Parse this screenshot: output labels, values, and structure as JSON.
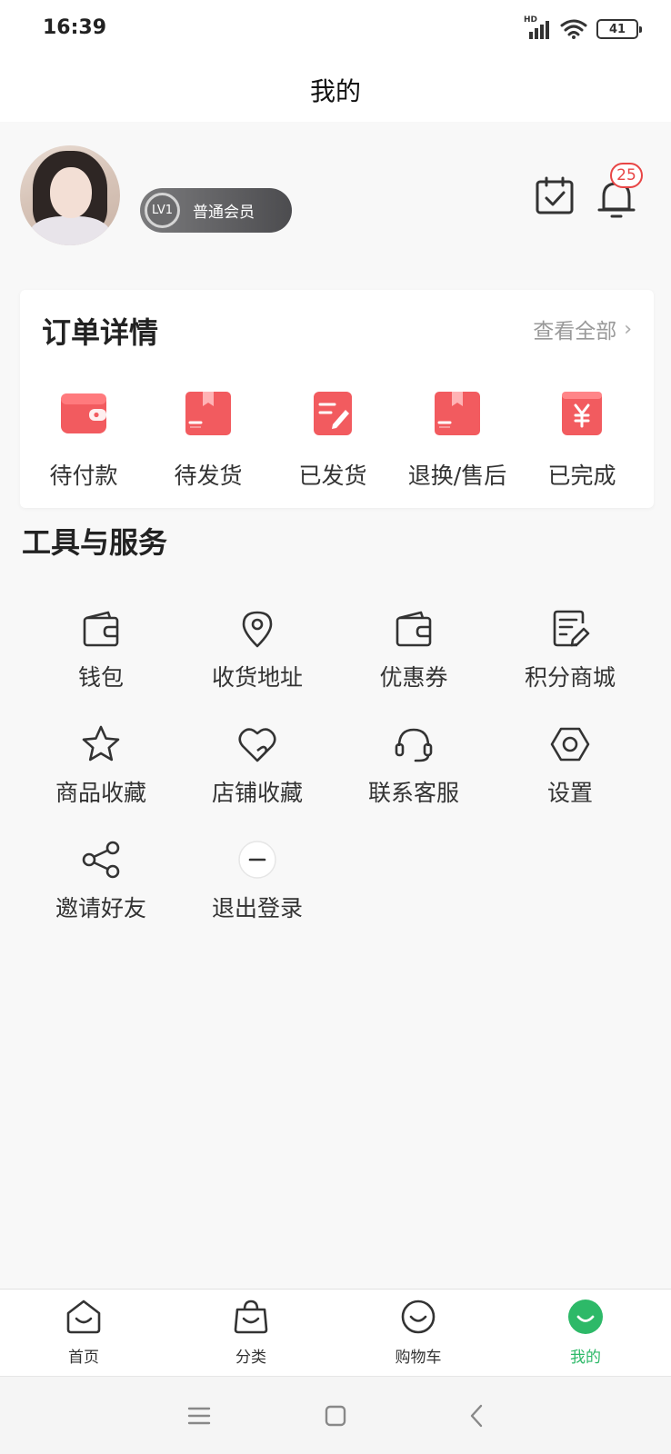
{
  "status_bar": {
    "time": "16:39",
    "signal_tag": "HD",
    "battery": "41"
  },
  "header": {
    "title": "我的"
  },
  "profile": {
    "level_badge": "LV1",
    "member_label": "普通会员",
    "notification_count": "25"
  },
  "orders": {
    "title": "订单详情",
    "view_all": "查看全部",
    "view_all_chevron": "›",
    "items": [
      {
        "label": "待付款",
        "icon": "wallet-icon"
      },
      {
        "label": "待发货",
        "icon": "package-icon"
      },
      {
        "label": "已发货",
        "icon": "note-icon"
      },
      {
        "label": "退换/售后",
        "icon": "return-package-icon"
      },
      {
        "label": "已完成",
        "icon": "yuan-bag-icon"
      }
    ]
  },
  "tools": {
    "title": "工具与服务",
    "items": [
      {
        "label": "钱包",
        "icon": "wallet-icon"
      },
      {
        "label": "收货地址",
        "icon": "location-pin-icon"
      },
      {
        "label": "优惠券",
        "icon": "coupon-wallet-icon"
      },
      {
        "label": "积分商城",
        "icon": "edit-document-icon"
      },
      {
        "label": "商品收藏",
        "icon": "star-icon"
      },
      {
        "label": "店铺收藏",
        "icon": "heart-icon"
      },
      {
        "label": "联系客服",
        "icon": "headset-icon"
      },
      {
        "label": "设置",
        "icon": "settings-hexagon-icon"
      },
      {
        "label": "邀请好友",
        "icon": "share-icon"
      },
      {
        "label": "退出登录",
        "icon": "minus-circle-icon"
      }
    ]
  },
  "tab_bar": {
    "active_color": "#2db968",
    "tabs": [
      {
        "label": "首页",
        "icon": "home-icon"
      },
      {
        "label": "分类",
        "icon": "shopping-bag-icon"
      },
      {
        "label": "购物车",
        "icon": "cart-smile-icon"
      },
      {
        "label": "我的",
        "icon": "profile-smile-icon",
        "active": true
      }
    ]
  },
  "colors": {
    "order_icon_red": "#f25b5f",
    "tab_active": "#2db968",
    "badge_red": "#e84545"
  }
}
